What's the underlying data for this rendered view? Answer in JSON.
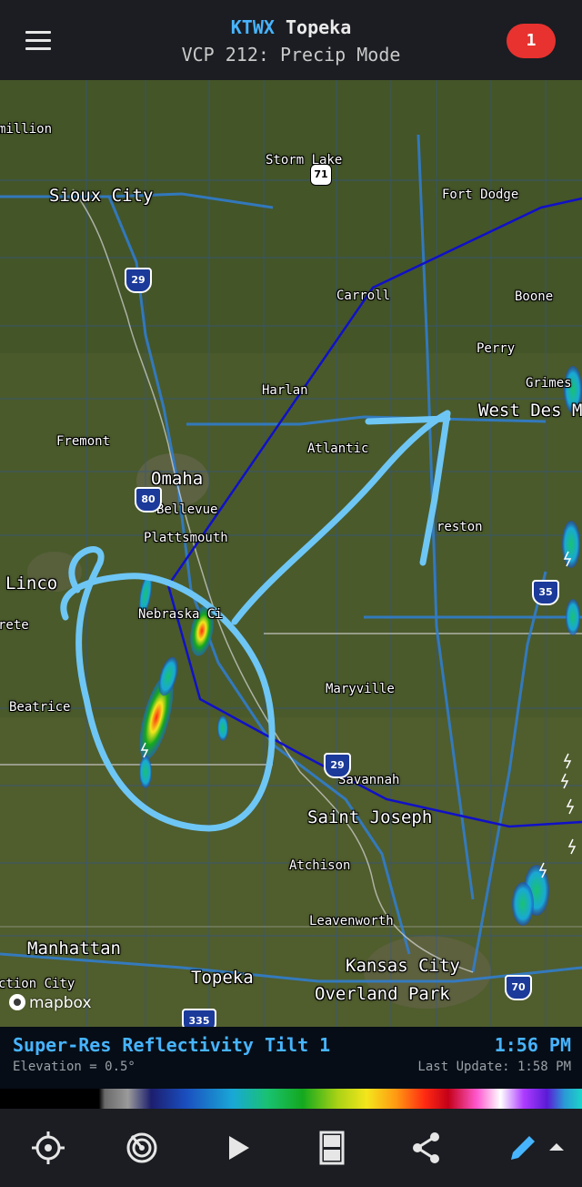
{
  "header": {
    "station_code": "KTWX",
    "station_name": "Topeka",
    "mode": "VCP 212: Precip Mode",
    "alert_count": "1"
  },
  "map": {
    "cities": [
      {
        "name": "million",
        "size": "normal"
      },
      {
        "name": "Storm Lake",
        "size": "normal"
      },
      {
        "name": "Sioux City",
        "size": "big"
      },
      {
        "name": "Fort Dodge",
        "size": "normal"
      },
      {
        "name": "Carroll",
        "size": "normal"
      },
      {
        "name": "Boone",
        "size": "normal"
      },
      {
        "name": "Perry",
        "size": "normal"
      },
      {
        "name": "Grimes",
        "size": "normal"
      },
      {
        "name": "Harlan",
        "size": "normal"
      },
      {
        "name": "West Des M",
        "size": "big"
      },
      {
        "name": "Fremont",
        "size": "normal"
      },
      {
        "name": "Atlantic",
        "size": "normal"
      },
      {
        "name": "Omaha",
        "size": "big"
      },
      {
        "name": "Bellevue",
        "size": "normal"
      },
      {
        "name": "Plattsmouth",
        "size": "normal"
      },
      {
        "name": "reston",
        "size": "normal"
      },
      {
        "name": "Linco",
        "size": "big"
      },
      {
        "name": "Nebraska Ci",
        "size": "normal"
      },
      {
        "name": "rete",
        "size": "normal"
      },
      {
        "name": "Maryville",
        "size": "normal"
      },
      {
        "name": "Beatrice",
        "size": "normal"
      },
      {
        "name": "Savannah",
        "size": "normal"
      },
      {
        "name": "Saint Joseph",
        "size": "big"
      },
      {
        "name": "Atchison",
        "size": "normal"
      },
      {
        "name": "Leavenworth",
        "size": "normal"
      },
      {
        "name": "Manhattan",
        "size": "big"
      },
      {
        "name": "Kansas City",
        "size": "big"
      },
      {
        "name": "ction City",
        "size": "normal"
      },
      {
        "name": "Topeka",
        "size": "big"
      },
      {
        "name": "Overland Park",
        "size": "big"
      }
    ],
    "shields": [
      {
        "type": "us",
        "number": "71"
      },
      {
        "type": "interstate",
        "number": "29"
      },
      {
        "type": "interstate",
        "number": "80"
      },
      {
        "type": "interstate",
        "number": "35"
      },
      {
        "type": "interstate",
        "number": "29"
      },
      {
        "type": "interstate",
        "number": "70"
      },
      {
        "type": "interstate",
        "number": "335"
      }
    ],
    "attribution": "mapbox"
  },
  "info": {
    "product": "Super-Res Reflectivity Tilt 1",
    "time": "1:56 PM",
    "elevation": "Elevation = 0.5°",
    "last_update": "Last Update: 1:58 PM"
  },
  "toolbar": {
    "buttons": [
      "locate-icon",
      "radar-sweep-icon",
      "play-icon",
      "layers-icon",
      "share-icon",
      "draw-pencil-icon"
    ]
  }
}
